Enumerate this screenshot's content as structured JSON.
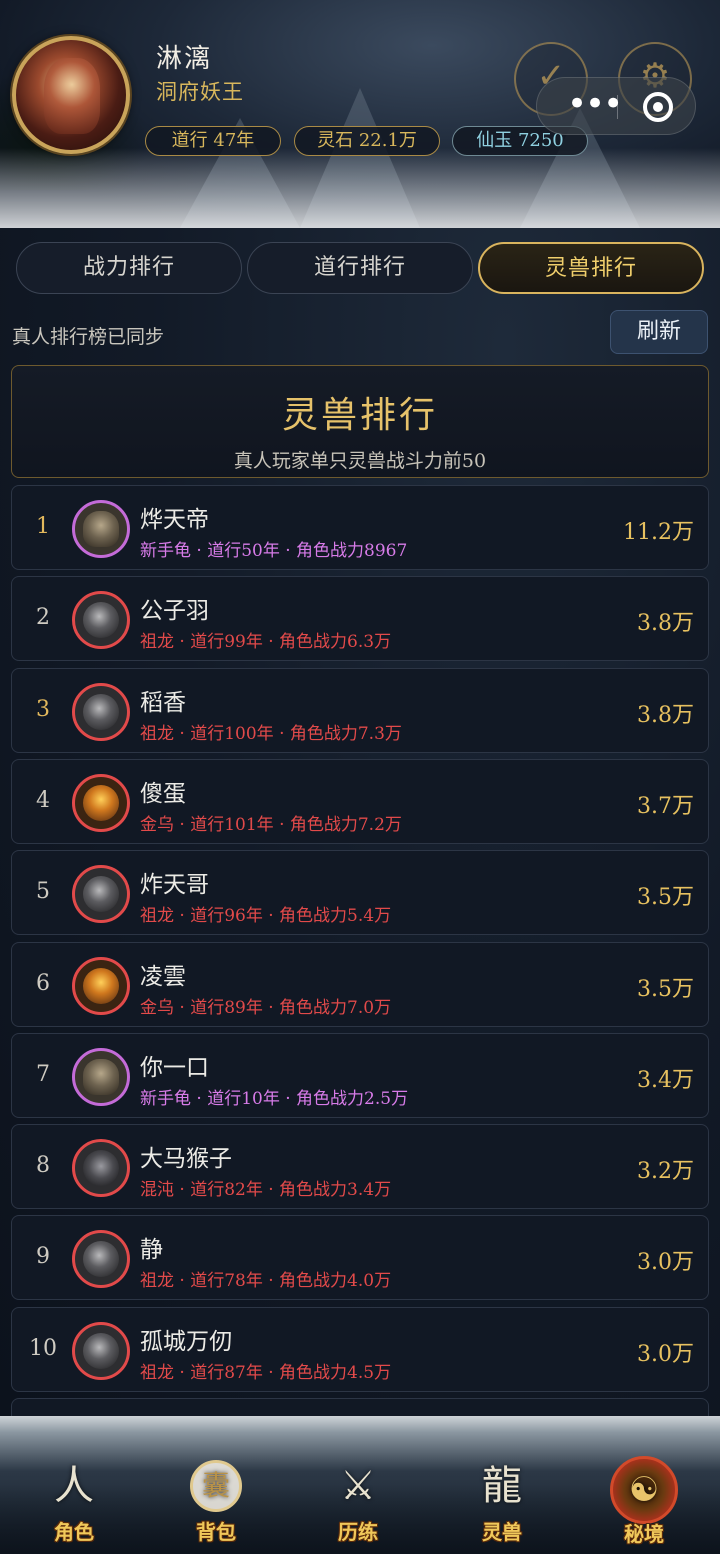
{
  "header": {
    "player_name": "淋漓",
    "player_title": "洞府妖王",
    "stats": {
      "daoxing": "道行 47年",
      "lingshi": "灵石 22.1万",
      "xianyu": "仙玉 7250"
    },
    "checkin_icon_glyph": "✓",
    "settings_icon_glyph": "⚙",
    "menu_glyph": "•••"
  },
  "tabs": [
    {
      "label": "战力排行",
      "active": false
    },
    {
      "label": "道行排行",
      "active": false
    },
    {
      "label": "灵兽排行",
      "active": true
    }
  ],
  "sync_text": "真人排行榜已同步",
  "refresh_label": "刷新",
  "banner": {
    "title": "灵兽排行",
    "subtitle": "真人玩家单只灵兽战斗力前50"
  },
  "rankings": [
    {
      "rank": "1",
      "name": "烨天帝",
      "detail": "新手龟 · 道行50年 · 角色战力8967",
      "power": "11.2万",
      "pet": "turtle",
      "rarity": "purple"
    },
    {
      "rank": "2",
      "name": "公子羽",
      "detail": "祖龙 · 道行99年 · 角色战力6.3万",
      "power": "3.8万",
      "pet": "dragon",
      "rarity": "red"
    },
    {
      "rank": "3",
      "name": "稻香",
      "detail": "祖龙 · 道行100年 · 角色战力7.3万",
      "power": "3.8万",
      "pet": "dragon",
      "rarity": "red"
    },
    {
      "rank": "4",
      "name": "傻蛋",
      "detail": "金乌 · 道行101年 · 角色战力7.2万",
      "power": "3.7万",
      "pet": "crow",
      "rarity": "red"
    },
    {
      "rank": "5",
      "name": "炸天哥",
      "detail": "祖龙 · 道行96年 · 角色战力5.4万",
      "power": "3.5万",
      "pet": "dragon",
      "rarity": "red"
    },
    {
      "rank": "6",
      "name": "凌雲",
      "detail": "金乌 · 道行89年 · 角色战力7.0万",
      "power": "3.5万",
      "pet": "crow",
      "rarity": "red"
    },
    {
      "rank": "7",
      "name": "你一口",
      "detail": "新手龟 · 道行10年 · 角色战力2.5万",
      "power": "3.4万",
      "pet": "turtle",
      "rarity": "purple"
    },
    {
      "rank": "8",
      "name": "大马猴子",
      "detail": "混沌 · 道行82年 · 角色战力3.4万",
      "power": "3.2万",
      "pet": "chaos",
      "rarity": "red"
    },
    {
      "rank": "9",
      "name": "静",
      "detail": "祖龙 · 道行78年 · 角色战力4.0万",
      "power": "3.0万",
      "pet": "dragon",
      "rarity": "red"
    },
    {
      "rank": "10",
      "name": "孤城万仞",
      "detail": "祖龙 · 道行87年 · 角色战力4.5万",
      "power": "3.0万",
      "pet": "dragon",
      "rarity": "red"
    }
  ],
  "bottom_nav": [
    {
      "label": "角色",
      "icon": "character-icon",
      "glyph": "人"
    },
    {
      "label": "背包",
      "icon": "bag-icon",
      "glyph": "囊"
    },
    {
      "label": "历练",
      "icon": "crossed-swords-icon",
      "glyph": "⚔"
    },
    {
      "label": "灵兽",
      "icon": "dragon-icon",
      "glyph": "龍"
    },
    {
      "label": "秘境",
      "icon": "taiji-icon",
      "glyph": "☯"
    }
  ],
  "colors": {
    "gold": "#e7c160",
    "rarity_red": "#e24a4a",
    "rarity_purple": "#c46bd8",
    "accent_tab": "#d9b45e"
  }
}
